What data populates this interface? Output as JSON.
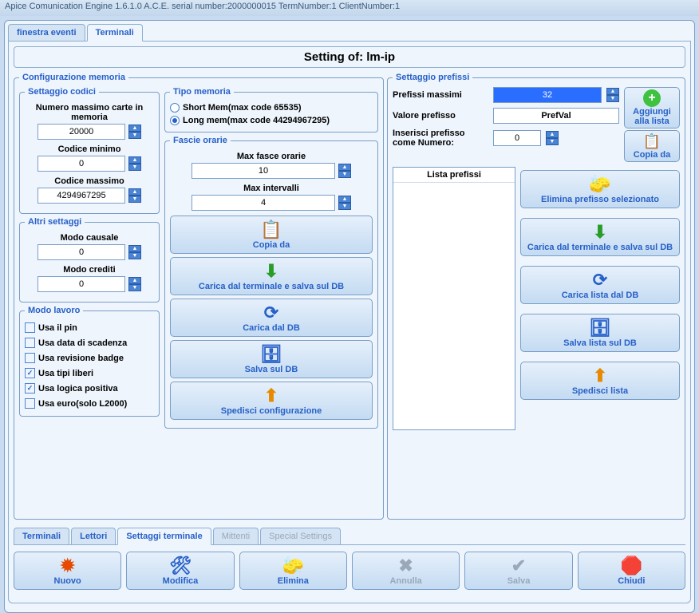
{
  "titlebar": "Apice Comunication Engine 1.6.1.0 A.C.E. serial number:2000000015 TermNumber:1 ClientNumber:1",
  "top_tabs": {
    "a": "finestra eventi",
    "b": "Terminali"
  },
  "setting_title": "Setting of: lm-ip",
  "config_mem": {
    "legend": "Configurazione memoria",
    "codici": {
      "legend": "Settaggio codici",
      "max_carte_lbl": "Numero massimo carte in memoria",
      "max_carte": "20000",
      "cod_min_lbl": "Codice minimo",
      "cod_min": "0",
      "cod_max_lbl": "Codice massimo",
      "cod_max": "4294967295"
    },
    "altri": {
      "legend": "Altri settaggi",
      "causale_lbl": "Modo causale",
      "causale": "0",
      "crediti_lbl": "Modo crediti",
      "crediti": "0"
    },
    "lavoro": {
      "legend": "Modo lavoro",
      "pin": "Usa il pin",
      "scadenza": "Usa data di scadenza",
      "badge": "Usa revisione badge",
      "tipi": "Usa tipi liberi",
      "positiva": "Usa logica positiva",
      "euro": "Usa euro(solo L2000)"
    },
    "tipo": {
      "legend": "Tipo memoria",
      "short": "Short Mem(max code 65535)",
      "long": "Long mem(max code 44294967295)"
    },
    "fascie": {
      "legend": "Fascie orarie",
      "max_fasce_lbl": "Max fasce orarie",
      "max_fasce": "10",
      "max_int_lbl": "Max intervalli",
      "max_int": "4"
    },
    "btns": {
      "copia": "Copia da",
      "carica_term": "Carica dal terminale e salva sul DB",
      "carica_db": "Carica dal DB",
      "salva_db": "Salva sul DB",
      "spedisci": "Spedisci configurazione"
    }
  },
  "prefissi": {
    "legend": "Settaggio prefissi",
    "max_lbl": "Prefissi massimi",
    "max": "32",
    "valore_lbl": "Valore prefisso",
    "valore": "PrefVal",
    "inserisci_lbl": "Inserisci prefisso come Numero:",
    "inserisci": "0",
    "aggiungi": "Aggiungi alla lista",
    "copia": "Copia da",
    "lista_lbl": "Lista prefissi",
    "btns": {
      "elimina": "Elimina prefisso selezionato",
      "carica_term": "Carica dal terminale e salva sul DB",
      "carica_db": "Carica lista dal DB",
      "salva_db": "Salva lista sul DB",
      "spedisci": "Spedisci lista"
    }
  },
  "sub_tabs": {
    "a": "Terminali",
    "b": "Lettori",
    "c": "Settaggi terminale",
    "d": "Mittenti",
    "e": "Special Settings"
  },
  "toolbar": {
    "nuovo": "Nuovo",
    "modifica": "Modifica",
    "elimina": "Elimina",
    "annulla": "Annulla",
    "salva": "Salva",
    "chiudi": "Chiudi"
  }
}
